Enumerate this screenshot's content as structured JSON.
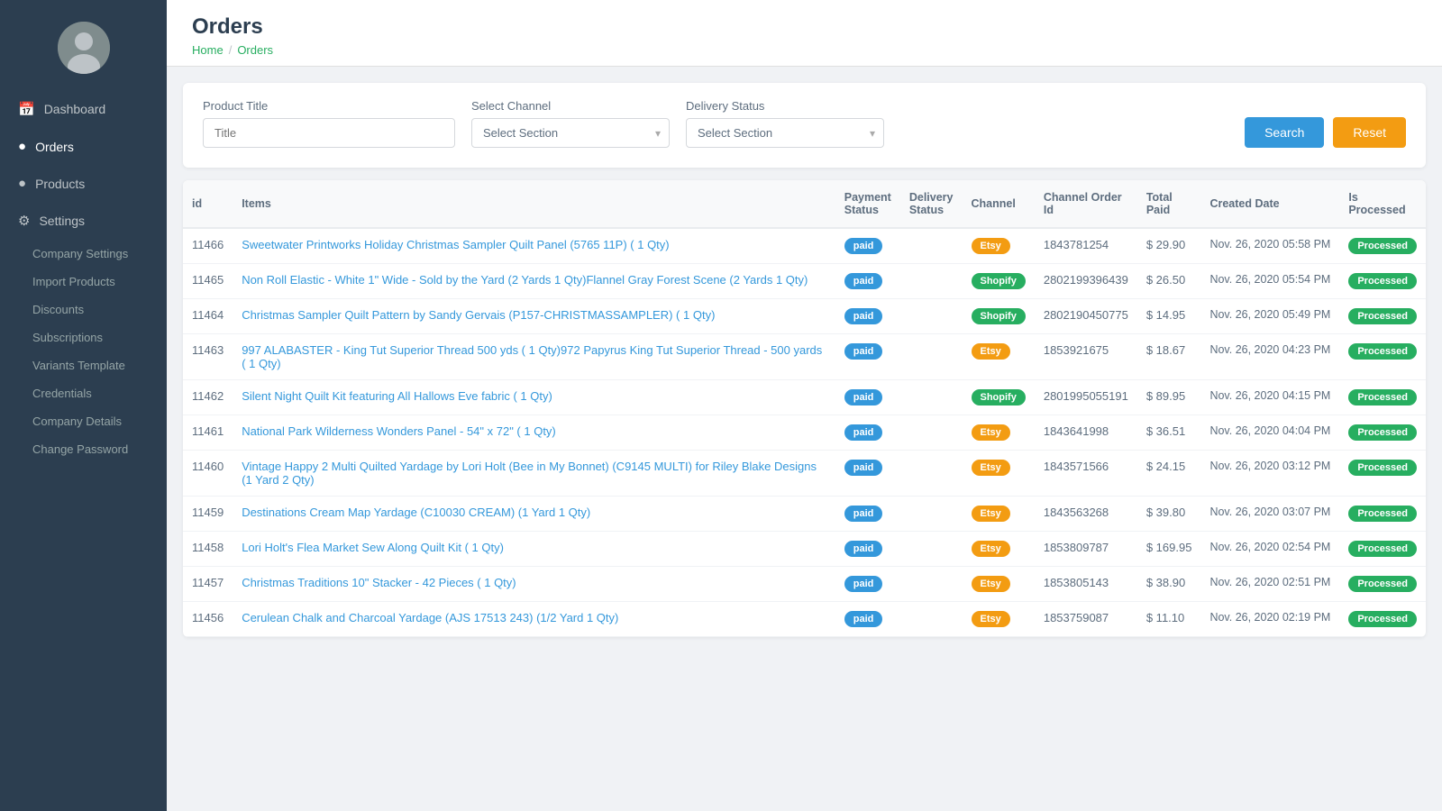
{
  "sidebar": {
    "nav_items": [
      {
        "id": "dashboard",
        "label": "Dashboard",
        "icon": "📅",
        "active": false
      },
      {
        "id": "orders",
        "label": "Orders",
        "icon": "●",
        "active": true
      },
      {
        "id": "products",
        "label": "Products",
        "icon": "●",
        "active": false
      },
      {
        "id": "settings",
        "label": "Settings",
        "icon": "⚙",
        "active": false
      }
    ],
    "sub_items": [
      {
        "id": "company-settings",
        "label": "Company Settings"
      },
      {
        "id": "import-products",
        "label": "Import Products"
      },
      {
        "id": "discounts",
        "label": "Discounts"
      },
      {
        "id": "subscriptions",
        "label": "Subscriptions"
      },
      {
        "id": "variants-template",
        "label": "Variants Template"
      },
      {
        "id": "credentials",
        "label": "Credentials"
      },
      {
        "id": "company-details",
        "label": "Company Details"
      },
      {
        "id": "change-password",
        "label": "Change Password"
      }
    ]
  },
  "header": {
    "title": "Orders",
    "breadcrumb_home": "Home",
    "breadcrumb_current": "Orders"
  },
  "filters": {
    "product_title_label": "Product Title",
    "product_title_placeholder": "Title",
    "select_channel_label": "Select Channel",
    "select_channel_placeholder": "Select Section",
    "delivery_status_label": "Delivery Status",
    "delivery_status_placeholder": "Select Section",
    "search_btn": "Search",
    "reset_btn": "Reset"
  },
  "table": {
    "columns": [
      "id",
      "Items",
      "Payment Status",
      "Delivery Status",
      "Channel",
      "Channel Order Id",
      "Total Paid",
      "Created Date",
      "Is Processed"
    ],
    "rows": [
      {
        "id": "11466",
        "items": [
          "Sweetwater Printworks Holiday Christmas Sampler Quilt Panel (5765 11P) ( 1 Qty)"
        ],
        "payment_status": "paid",
        "delivery_status": "",
        "channel": "Etsy",
        "channel_order_id": "1843781254",
        "total_paid": "$ 29.90",
        "created_date": "Nov. 26, 2020 05:58 PM",
        "is_processed": "Processed"
      },
      {
        "id": "11465",
        "items": [
          "Non Roll Elastic - White 1\" Wide - Sold by the Yard (2 Yards 1 Qty)",
          "Flannel Gray Forest Scene (2 Yards 1 Qty)"
        ],
        "payment_status": "paid",
        "delivery_status": "",
        "channel": "Shopify",
        "channel_order_id": "2802199396439",
        "total_paid": "$ 26.50",
        "created_date": "Nov. 26, 2020 05:54 PM",
        "is_processed": "Processed"
      },
      {
        "id": "11464",
        "items": [
          "Christmas Sampler Quilt Pattern by Sandy Gervais (P157-CHRISTMASSAMPLER) ( 1 Qty)"
        ],
        "payment_status": "paid",
        "delivery_status": "",
        "channel": "Shopify",
        "channel_order_id": "2802190450775",
        "total_paid": "$ 14.95",
        "created_date": "Nov. 26, 2020 05:49 PM",
        "is_processed": "Processed"
      },
      {
        "id": "11463",
        "items": [
          "997 ALABASTER - King Tut Superior Thread 500 yds ( 1 Qty)",
          "972 Papyrus King Tut Superior Thread - 500 yards ( 1 Qty)"
        ],
        "payment_status": "paid",
        "delivery_status": "",
        "channel": "Etsy",
        "channel_order_id": "1853921675",
        "total_paid": "$ 18.67",
        "created_date": "Nov. 26, 2020 04:23 PM",
        "is_processed": "Processed"
      },
      {
        "id": "11462",
        "items": [
          "Silent Night Quilt Kit featuring All Hallows Eve fabric ( 1 Qty)"
        ],
        "payment_status": "paid",
        "delivery_status": "",
        "channel": "Shopify",
        "channel_order_id": "2801995055191",
        "total_paid": "$ 89.95",
        "created_date": "Nov. 26, 2020 04:15 PM",
        "is_processed": "Processed"
      },
      {
        "id": "11461",
        "items": [
          "National Park Wilderness Wonders Panel - 54\" x 72\" ( 1 Qty)"
        ],
        "payment_status": "paid",
        "delivery_status": "",
        "channel": "Etsy",
        "channel_order_id": "1843641998",
        "total_paid": "$ 36.51",
        "created_date": "Nov. 26, 2020 04:04 PM",
        "is_processed": "Processed"
      },
      {
        "id": "11460",
        "items": [
          "Vintage Happy 2 Multi Quilted Yardage by Lori Holt (Bee in My Bonnet) (C9145 MULTI) for Riley Blake Designs (1 Yard 2 Qty)"
        ],
        "payment_status": "paid",
        "delivery_status": "",
        "channel": "Etsy",
        "channel_order_id": "1843571566",
        "total_paid": "$ 24.15",
        "created_date": "Nov. 26, 2020 03:12 PM",
        "is_processed": "Processed"
      },
      {
        "id": "11459",
        "items": [
          "Destinations Cream Map Yardage (C10030 CREAM) (1 Yard 1 Qty)"
        ],
        "payment_status": "paid",
        "delivery_status": "",
        "channel": "Etsy",
        "channel_order_id": "1843563268",
        "total_paid": "$ 39.80",
        "created_date": "Nov. 26, 2020 03:07 PM",
        "is_processed": "Processed"
      },
      {
        "id": "11458",
        "items": [
          "Lori Holt's Flea Market Sew Along Quilt Kit ( 1 Qty)"
        ],
        "payment_status": "paid",
        "delivery_status": "",
        "channel": "Etsy",
        "channel_order_id": "1853809787",
        "total_paid": "$ 169.95",
        "created_date": "Nov. 26, 2020 02:54 PM",
        "is_processed": "Processed"
      },
      {
        "id": "11457",
        "items": [
          "Christmas Traditions 10\" Stacker - 42 Pieces ( 1 Qty)"
        ],
        "payment_status": "paid",
        "delivery_status": "",
        "channel": "Etsy",
        "channel_order_id": "1853805143",
        "total_paid": "$ 38.90",
        "created_date": "Nov. 26, 2020 02:51 PM",
        "is_processed": "Processed"
      },
      {
        "id": "11456",
        "items": [
          "Cerulean Chalk and Charcoal Yardage (AJS 17513 243) (1/2 Yard 1 Qty)"
        ],
        "payment_status": "paid",
        "delivery_status": "",
        "channel": "Etsy",
        "channel_order_id": "1853759087",
        "total_paid": "$ 11.10",
        "created_date": "Nov. 26, 2020 02:19 PM",
        "is_processed": "Processed"
      }
    ]
  }
}
